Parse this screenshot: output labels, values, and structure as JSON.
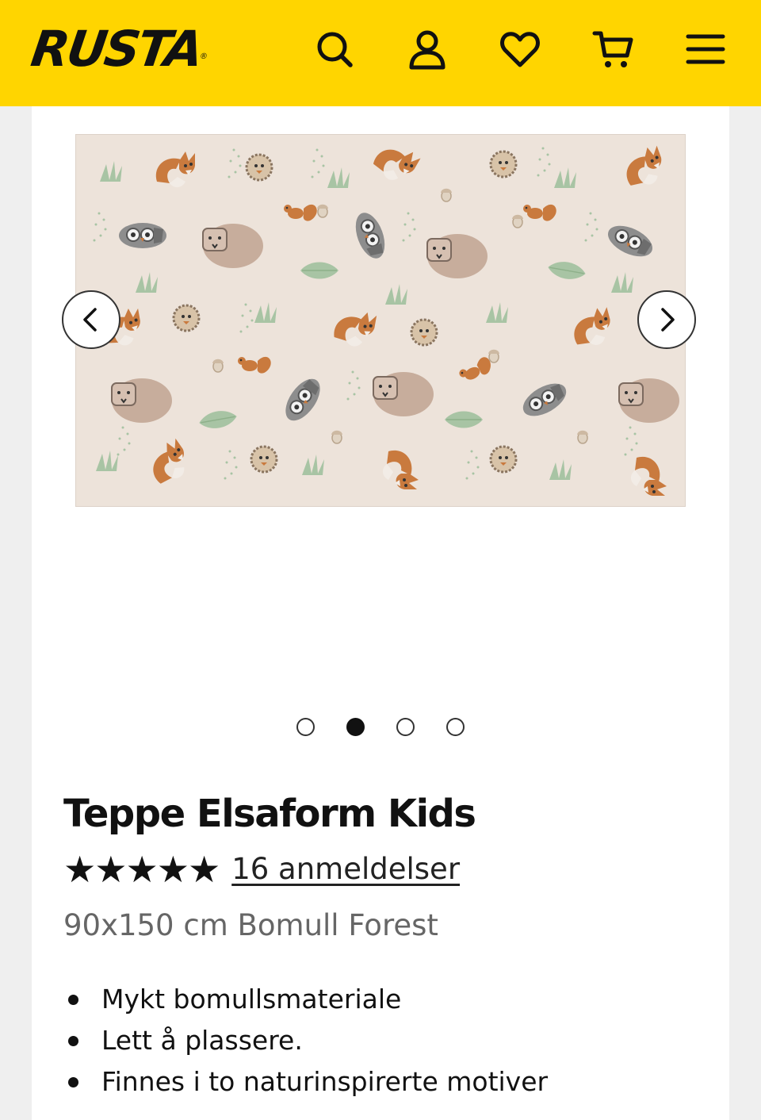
{
  "header": {
    "logo": "RUSTA",
    "logo_mark": "®",
    "icons": [
      "search-icon",
      "account-icon",
      "heart-icon",
      "cart-icon",
      "menu-icon"
    ],
    "background": "#ffd500"
  },
  "gallery": {
    "image": "rug-forest-pattern",
    "prev_icon": "chevron-left-icon",
    "next_icon": "chevron-right-icon",
    "slide_count": 4,
    "active_index": 1
  },
  "product": {
    "title": "Teppe Elsaform Kids",
    "stars": "★★★★★",
    "rating": 5,
    "reviews_link": "16 anmeldelser",
    "subtitle": "90x150 cm Bomull Forest",
    "features": [
      "Mykt bomullsmateriale",
      "Lett å plassere.",
      "Finnes i to naturinspirerte motiver"
    ]
  },
  "colors": {
    "accent": "#ffd500",
    "rug_background": "#ede3da",
    "fox": "#c97a3e",
    "owl": "#8d8d8d",
    "bear": "#c7ad9c",
    "leaf": "#a8c4a4"
  }
}
